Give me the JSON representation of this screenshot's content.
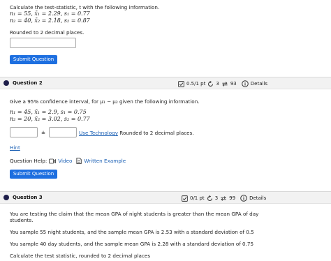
{
  "q1": {
    "prompt": "Calculate the test-statistic, t with the following information.",
    "line1": {
      "n": "n₁ = 55,",
      "x": "x̄₁ = 2.29,",
      "s": "s₁ = 0.77"
    },
    "line2": {
      "n": "n₂ = 40,",
      "x": "x̄₂ = 2.18,",
      "s": "s₂ = 0.87"
    },
    "rounding": "Rounded to 2 decimal places.",
    "answer_value": "",
    "submit_label": "Submit Question"
  },
  "q2": {
    "title": "Question 2",
    "points": "0.5/1 pt",
    "retries": "3",
    "attempts": "93",
    "details": "Details",
    "prompt": "Give a 95% confidence interval, for μ₁ − μ₂ given the following information.",
    "line1": {
      "n": "n₁ = 45,",
      "x": "x̄₁ = 2.9,",
      "s": "s₁ = 0.75"
    },
    "line2": {
      "n": "n₂ = 20,",
      "x": "x̄₂ = 3.02,",
      "s": "s₂ = 0.77"
    },
    "plusminus": "±",
    "lower_value": "",
    "upper_value": "",
    "technology_link": "Use Technology",
    "rounding": "Rounded to 2 decimal places.",
    "hint": "Hint",
    "help_label": "Question Help:",
    "video": "Video",
    "written_example": "Written Example",
    "submit_label": "Submit Question"
  },
  "q3": {
    "title": "Question 3",
    "points": "0/1 pt",
    "retries": "3",
    "attempts": "99",
    "details": "Details",
    "p1a": "You are testing the claim that the mean GPA of night students is greater than the mean GPA of day",
    "p1b": "students.",
    "p2": "You sample 55 night students, and the sample mean GPA is 2.53 with a standard deviation of 0.5",
    "p3": "You sample 40 day students, and the sample mean GPA is 2.28 with a standard deviation of 0.75",
    "p4": "Calculate the test statistic, rounded to 2 decimal places"
  },
  "colors": {
    "accent": "#1d6fe0",
    "link": "#1a5fb4",
    "dot": "#1e1e4a",
    "header_bg": "#f2f2f2"
  }
}
